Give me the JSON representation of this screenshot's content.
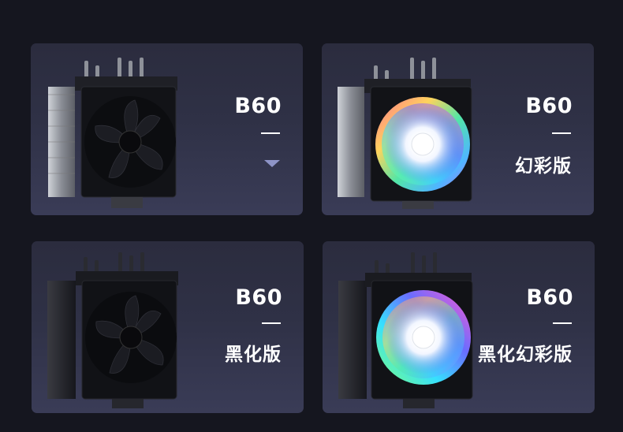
{
  "cards": [
    {
      "model": "B60",
      "variant": "",
      "style": "standard"
    },
    {
      "model": "B60",
      "variant": "幻彩版",
      "style": "argb"
    },
    {
      "model": "B60",
      "variant": "黑化版",
      "style": "black"
    },
    {
      "model": "B60",
      "variant": "黑化幻彩版",
      "style": "black-argb"
    }
  ],
  "colors": {
    "page_background": "#15161f",
    "card_top": "#2b2c3e",
    "card_bottom": "#3a3c57",
    "caret": "#8e94c7"
  },
  "icons": [
    "chevron-down-icon"
  ]
}
